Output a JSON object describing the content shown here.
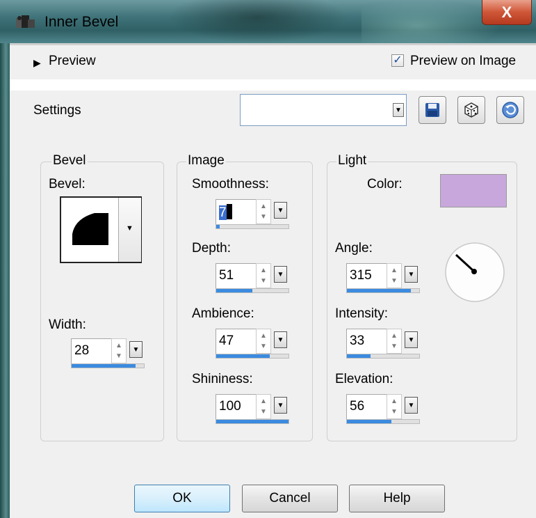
{
  "window": {
    "title": "Inner Bevel",
    "close_label": "X"
  },
  "preview": {
    "label": "Preview",
    "arrow": "▶",
    "checkbox_label": "Preview on Image",
    "checkbox_mark": "✓",
    "checked": true
  },
  "settings": {
    "label": "Settings",
    "combo_value": "",
    "combo_arrow": "▼"
  },
  "bevel_group": {
    "title": "Bevel",
    "bevel_label": "Bevel:",
    "width_label": "Width:",
    "width_value": "28",
    "width_fraction": 0.88
  },
  "image_group": {
    "title": "Image",
    "smoothness_label": "Smoothness:",
    "smoothness_value": "7",
    "smoothness_fraction": 0.05,
    "depth_label": "Depth:",
    "depth_value": "51",
    "depth_fraction": 0.5,
    "ambience_label": "Ambience:",
    "ambience_value": "47",
    "ambience_fraction": 0.74,
    "shininess_label": "Shininess:",
    "shininess_value": "100",
    "shininess_fraction": 1.0
  },
  "light_group": {
    "title": "Light",
    "color_label": "Color:",
    "color": "#c8a8dc",
    "angle_label": "Angle:",
    "angle_value": "315",
    "angle_fraction": 0.88,
    "intensity_label": "Intensity:",
    "intensity_value": "33",
    "intensity_fraction": 0.33,
    "elevation_label": "Elevation:",
    "elevation_value": "56",
    "elevation_fraction": 0.62
  },
  "buttons": {
    "ok": "OK",
    "cancel": "Cancel",
    "help": "Help"
  },
  "colors": {
    "accent": "#3b8be0",
    "light_color": "#c8a8dc"
  }
}
